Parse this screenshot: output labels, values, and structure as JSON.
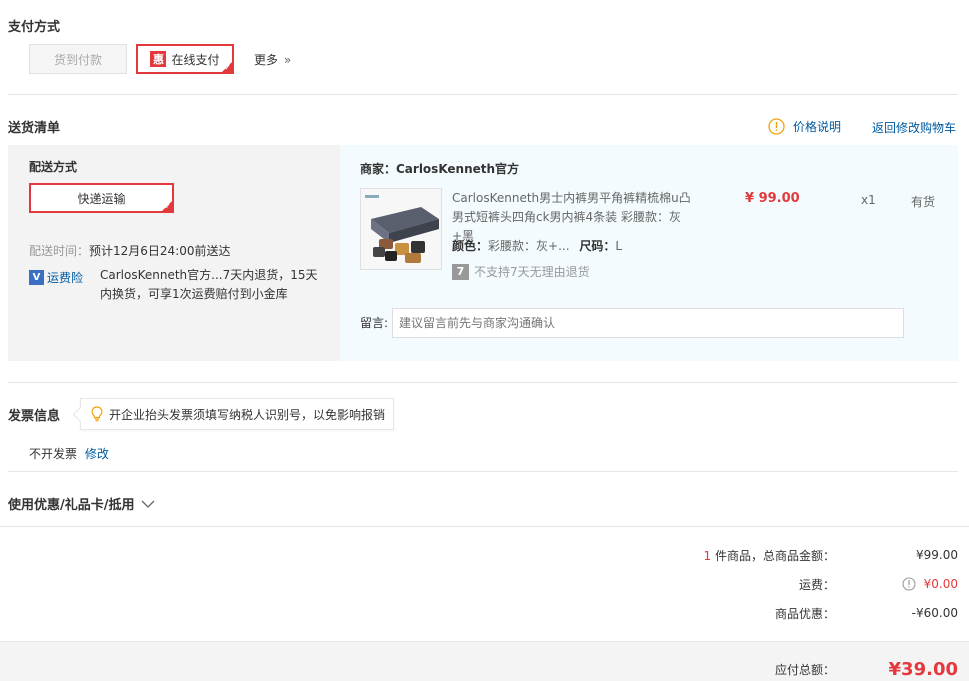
{
  "payment": {
    "title": "支付方式",
    "cod_label": "货到付款",
    "online_label": "在线支付",
    "hui_badge": "惠",
    "more_label": "更多",
    "more_chevron": "»"
  },
  "delivery": {
    "title": "送货清单",
    "price_note": "价格说明",
    "back_cart": "返回修改购物车",
    "method_title": "配送方式",
    "method_option": "快递运输",
    "time_label": "配送时间：",
    "time_value": "预计12月6日24:00前送达",
    "insurance_badge": "V",
    "insurance_label": "运费险",
    "insurance_desc": "CarlosKenneth官方...7天内退货，15天内换货，可享1次运费赔付到小金库"
  },
  "merchant": {
    "label": "商家：CarlosKenneth官方",
    "product": {
      "name": "CarlosKenneth男士内裤男平角裤精梳棉u凸男式短裤头四角ck男内裤4条装 彩腰款：灰+黑",
      "price": "¥ 99.00",
      "qty": "x1",
      "stock": "有货",
      "color_label": "颜色：",
      "color_value": "彩腰款：灰+...",
      "size_label": "尺码：",
      "size_value": "L",
      "return_badge": "7",
      "return_note": "不支持7天无理由退货"
    },
    "message_label": "留言:",
    "message_placeholder": "建议留言前先与商家沟通确认"
  },
  "invoice": {
    "title": "发票信息",
    "tip": "开企业抬头发票须填写纳税人识别号，以免影响报销",
    "status": "不开发票",
    "edit": "修改"
  },
  "coupon": {
    "title": "使用优惠/礼品卡/抵用"
  },
  "summary": {
    "count": "1",
    "count_suffix": "件商品，总商品金额：",
    "goods_total": "¥99.00",
    "shipping_label": "运费：",
    "shipping_value": "¥0.00",
    "discount_label": "商品优惠：",
    "discount_value": "-¥60.00",
    "total_label": "应付总额：",
    "total_value": "¥39.00"
  },
  "colors": {
    "accent": "#e4393c",
    "link": "#005aa0",
    "warning": "#f0a30a"
  }
}
